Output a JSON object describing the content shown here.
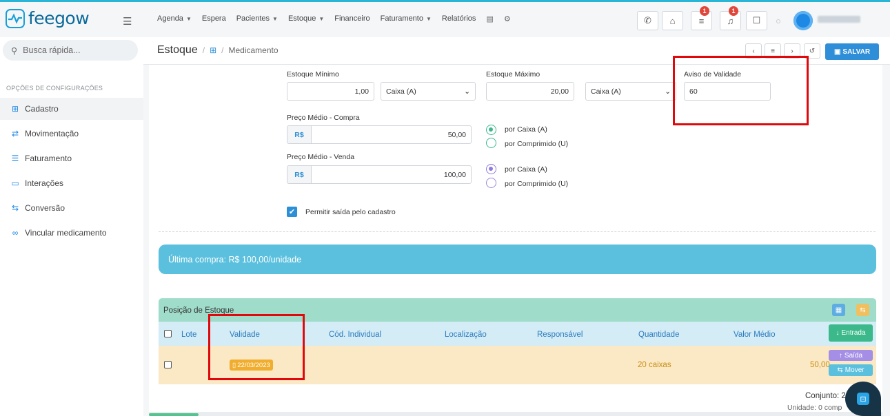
{
  "app": {
    "logo_text": "feegow"
  },
  "topnav": [
    {
      "label": "Agenda",
      "dropdown": true
    },
    {
      "label": "Espera",
      "dropdown": false
    },
    {
      "label": "Pacientes",
      "dropdown": true
    },
    {
      "label": "Estoque",
      "dropdown": true
    },
    {
      "label": "Financeiro",
      "dropdown": false
    },
    {
      "label": "Faturamento",
      "dropdown": true
    },
    {
      "label": "Relatórios",
      "dropdown": false
    }
  ],
  "header_badges": {
    "tasks": "1",
    "notifications": "1"
  },
  "sidebar": {
    "search_placeholder": "Busca rápida...",
    "section_title": "OPÇÕES DE CONFIGURAÇÕES",
    "items": [
      {
        "label": "Cadastro",
        "icon": "plus-box-icon",
        "active": true
      },
      {
        "label": "Movimentação",
        "icon": "transfer-arrows-icon",
        "active": false
      },
      {
        "label": "Faturamento",
        "icon": "list-icon",
        "active": false
      },
      {
        "label": "Interações",
        "icon": "folder-icon",
        "active": false
      },
      {
        "label": "Conversão",
        "icon": "convert-icon",
        "active": false
      },
      {
        "label": "Vincular medicamento",
        "icon": "link-icon",
        "active": false
      }
    ]
  },
  "breadcrumb": {
    "main": "Estoque",
    "sep1": "/",
    "sep2": "/",
    "sub": "Medicamento"
  },
  "toolbar": {
    "save_label": "SALVAR"
  },
  "form": {
    "estoque_minimo": {
      "label": "Estoque Mínimo",
      "value": "1,00",
      "unit": "Caixa (A)"
    },
    "estoque_maximo": {
      "label": "Estoque Máximo",
      "value": "20,00",
      "unit": "Caixa (A)"
    },
    "aviso_validade": {
      "label": "Aviso de Validade",
      "value": "60"
    },
    "preco_compra": {
      "label": "Preço Médio - Compra",
      "currency": "R$",
      "value": "50,00",
      "opt1": "por Caixa (A)",
      "opt2": "por Comprimido (U)"
    },
    "preco_venda": {
      "label": "Preço Médio - Venda",
      "currency": "R$",
      "value": "100,00",
      "opt1": "por Caixa (A)",
      "opt2": "por Comprimido (U)"
    },
    "permitir_saida": {
      "label": "Permitir saída pelo cadastro",
      "checked": true
    }
  },
  "banner": {
    "text": "Última compra: R$ 100,00/unidade"
  },
  "stock_panel": {
    "title": "Posição de Estoque",
    "columns": [
      "Lote",
      "Validade",
      "Cód. Individual",
      "Localização",
      "Responsável",
      "Quantidade",
      "Valor Médio"
    ],
    "entrada_label": "Entrada",
    "rows": [
      {
        "lote": "",
        "validade": "22/03/2023",
        "cod": "",
        "localizacao": "",
        "responsavel": "",
        "quantidade": "20 caixas",
        "valor_medio": "50,00",
        "saida_label": "Saída",
        "mover_label": "Mover"
      }
    ],
    "footer_conjunto": "Conjunto: 2",
    "footer_unidade": "Unidade: 0 comp"
  },
  "colors": {
    "accent": "#2f8ed8",
    "banner": "#5bc0de",
    "panel": "#9fdcc9",
    "highlight": "#e0080a"
  }
}
